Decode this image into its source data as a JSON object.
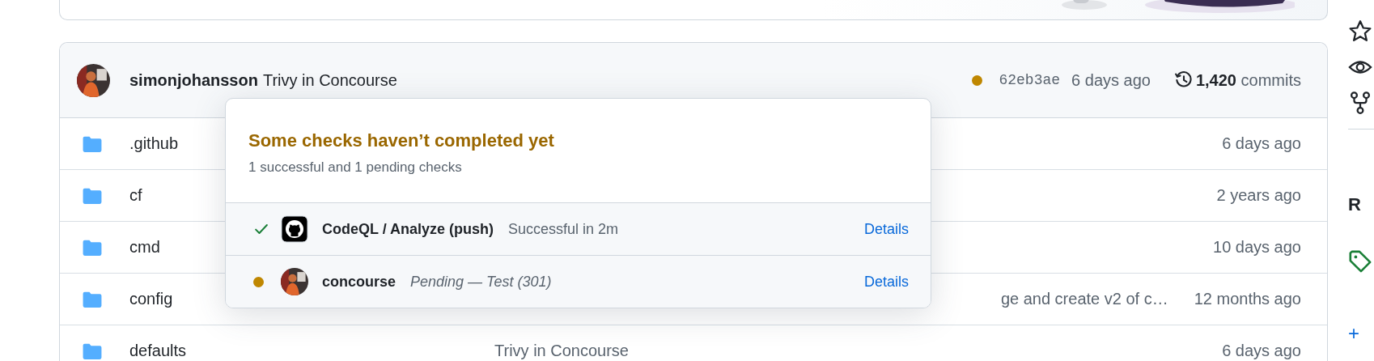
{
  "latest_commit": {
    "author": "simonjohansson",
    "message": "Trivy in Concourse",
    "pending": true,
    "sha": "62eb3ae",
    "time": "6 days ago",
    "commit_count": "1,420",
    "commit_label": "commits"
  },
  "files": [
    {
      "name": ".github",
      "time": "6 days ago"
    },
    {
      "name": "cf",
      "time": "2 years ago"
    },
    {
      "name": "cmd",
      "time": "10 days ago"
    },
    {
      "name": "config",
      "message": "ge and create v2 of c…",
      "covered": true,
      "time": "12 months ago"
    },
    {
      "name": "defaults",
      "message": "Trivy in Concourse",
      "covered": false,
      "time": "6 days ago"
    }
  ],
  "checks_popup": {
    "title": "Some checks haven’t completed yet",
    "summary": "1 successful and 1 pending checks",
    "checks": [
      {
        "passed": true,
        "kind": "github",
        "name": "CodeQL / Analyze (push)",
        "description": "Successful in 2m",
        "link": "Details"
      },
      {
        "passed": false,
        "kind": "avatar",
        "name": "concourse",
        "description": "Pending — Test (301)",
        "link": "Details"
      }
    ]
  },
  "sidebar": {
    "heading": "R",
    "add": "+"
  }
}
